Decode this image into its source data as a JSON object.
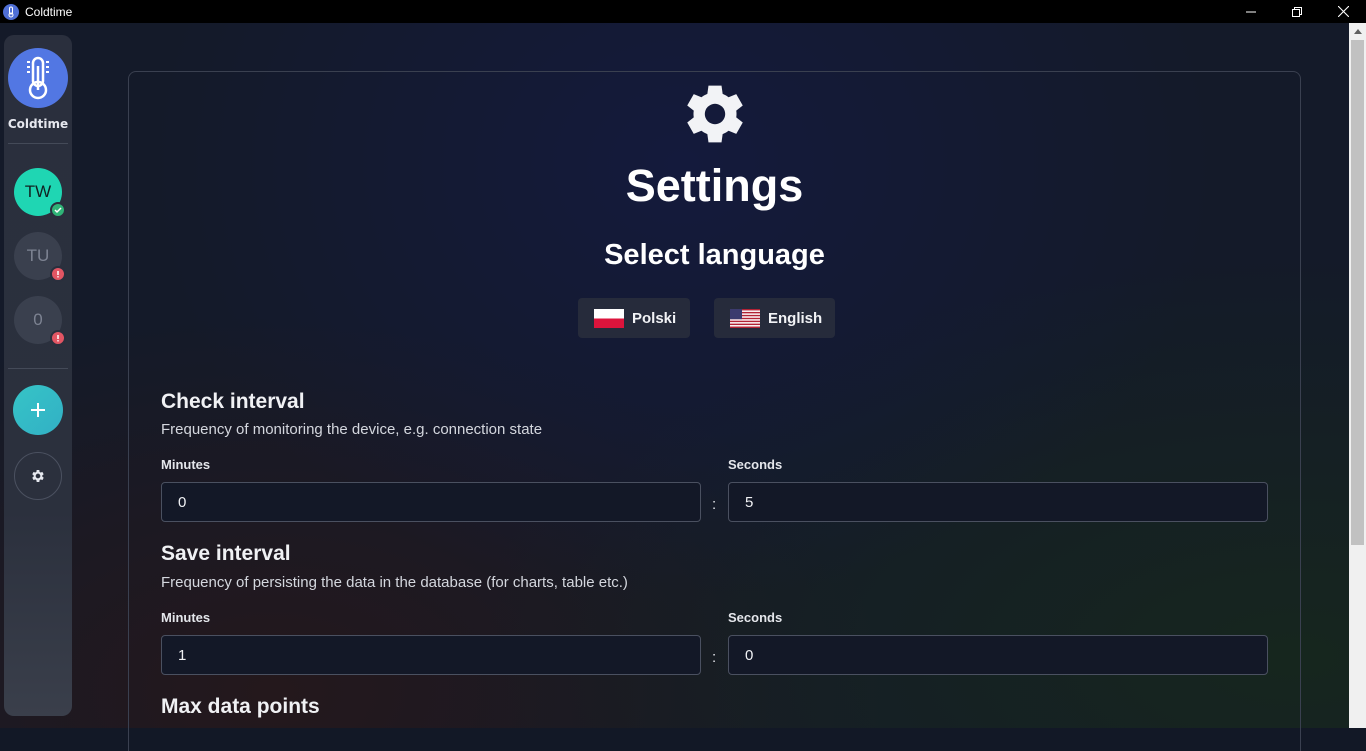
{
  "window": {
    "title": "Coldtime",
    "controls": [
      "minimize",
      "restore",
      "close"
    ]
  },
  "sidebar": {
    "brand_name": "Coldtime",
    "devices": [
      {
        "initials": "TW",
        "status": "ok"
      },
      {
        "initials": "TU",
        "status": "error"
      },
      {
        "initials": "0",
        "status": "error"
      }
    ],
    "add_label": "+"
  },
  "settings": {
    "title": "Settings",
    "language": {
      "heading": "Select language",
      "options": [
        {
          "label": "Polski",
          "flag": "pl-flag-icon"
        },
        {
          "label": "English",
          "flag": "us-flag-icon"
        }
      ]
    },
    "check_interval": {
      "title": "Check interval",
      "description": "Frequency of monitoring the device, e.g. connection state",
      "minutes_label": "Minutes",
      "seconds_label": "Seconds",
      "minutes_value": "0",
      "seconds_value": "5",
      "separator": ":"
    },
    "save_interval": {
      "title": "Save interval",
      "description": "Frequency of persisting the data in the database (for charts, table etc.)",
      "minutes_label": "Minutes",
      "seconds_label": "Seconds",
      "minutes_value": "1",
      "seconds_value": "0",
      "separator": ":"
    },
    "max_data_points": {
      "title": "Max data points"
    }
  },
  "colors": {
    "accent": "#5277e3",
    "device_ok": "#1fd6b3",
    "add_button": "#36c4c6",
    "status_ok": "#2fb477",
    "status_error": "#e25563"
  }
}
